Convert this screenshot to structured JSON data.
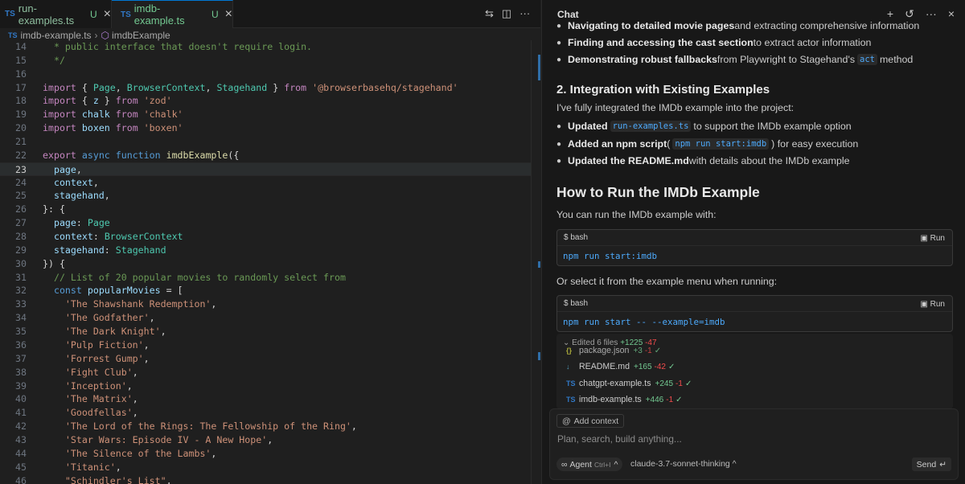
{
  "editor": {
    "tabs": [
      {
        "lang": "TS",
        "name": "run-examples.ts",
        "status": "U"
      },
      {
        "lang": "TS",
        "name": "imdb-example.ts",
        "status": "U"
      }
    ],
    "breadcrumb": {
      "lang": "TS",
      "file": "imdb-example.ts",
      "symbol": "imdbExample"
    },
    "lines": [
      {
        "n": "14",
        "t": "  * public interface that doesn't require login."
      },
      {
        "n": "15",
        "t": "  */"
      },
      {
        "n": "16",
        "t": ""
      },
      {
        "n": "17",
        "t": "import { Page, BrowserContext, Stagehand } from '@browserbasehq/stagehand'"
      },
      {
        "n": "18",
        "t": "import { z } from 'zod'"
      },
      {
        "n": "19",
        "t": "import chalk from 'chalk'"
      },
      {
        "n": "20",
        "t": "import boxen from 'boxen'"
      },
      {
        "n": "21",
        "t": ""
      },
      {
        "n": "22",
        "t": "export async function imdbExample({"
      },
      {
        "n": "23",
        "t": "  page,"
      },
      {
        "n": "24",
        "t": "  context,"
      },
      {
        "n": "25",
        "t": "  stagehand,"
      },
      {
        "n": "26",
        "t": "}: {"
      },
      {
        "n": "27",
        "t": "  page: Page"
      },
      {
        "n": "28",
        "t": "  context: BrowserContext"
      },
      {
        "n": "29",
        "t": "  stagehand: Stagehand"
      },
      {
        "n": "30",
        "t": "}) {"
      },
      {
        "n": "31",
        "t": "  // List of 20 popular movies to randomly select from"
      },
      {
        "n": "32",
        "t": "  const popularMovies = ["
      },
      {
        "n": "33",
        "t": "    'The Shawshank Redemption',"
      },
      {
        "n": "34",
        "t": "    'The Godfather',"
      },
      {
        "n": "35",
        "t": "    'The Dark Knight',"
      },
      {
        "n": "36",
        "t": "    'Pulp Fiction',"
      },
      {
        "n": "37",
        "t": "    'Forrest Gump',"
      },
      {
        "n": "38",
        "t": "    'Fight Club',"
      },
      {
        "n": "39",
        "t": "    'Inception',"
      },
      {
        "n": "40",
        "t": "    'The Matrix',"
      },
      {
        "n": "41",
        "t": "    'Goodfellas',"
      },
      {
        "n": "42",
        "t": "    'The Lord of the Rings: The Fellowship of the Ring',"
      },
      {
        "n": "43",
        "t": "    'Star Wars: Episode IV - A New Hope',"
      },
      {
        "n": "44",
        "t": "    'The Silence of the Lambs',"
      },
      {
        "n": "45",
        "t": "    'Titanic',"
      },
      {
        "n": "46",
        "t": "    \"Schindler's List\","
      }
    ],
    "active_line": "23"
  },
  "chat": {
    "title": "Chat",
    "bullets_top": [
      {
        "bold": "Navigating to detailed movie pages",
        "rest": " and extracting comprehensive information",
        "code": "",
        "after": ""
      },
      {
        "bold": "Finding and accessing the cast section",
        "rest": " to extract actor information",
        "code": "",
        "after": ""
      },
      {
        "bold": "Demonstrating robust fallbacks",
        "rest": " from Playwright to Stagehand's",
        "code": "act",
        "after": " method"
      }
    ],
    "h2": "2. Integration with Existing Examples",
    "para1": "I've fully integrated the IMDb example into the project:",
    "bullets_mid": [
      {
        "bold": "Updated",
        "rest": "",
        "code": "run-examples.ts",
        "after": "to support the IMDb example option"
      },
      {
        "bold": "Added an npm script",
        "rest": " (",
        "code": "npm run start:imdb",
        "after": ") for easy execution"
      },
      {
        "bold": "Updated the README.md",
        "rest": " with details about the IMDb example",
        "code": "",
        "after": ""
      }
    ],
    "h1": "How to Run the IMDb Example",
    "para2": "You can run the IMDb example with:",
    "code1": {
      "lang": "$ bash",
      "run": "Run",
      "cmd": "npm run start:imdb"
    },
    "para3": "Or select it from the example menu when running:",
    "code2": {
      "lang": "$ bash",
      "run": "Run",
      "cmd": "npm run start -- --example=imdb"
    },
    "edited": {
      "label": "Edited 6 files",
      "add": "+1225",
      "del": "-47",
      "files": [
        {
          "icon": "{}",
          "name": "package.json",
          "add": "+3",
          "del": "-1"
        },
        {
          "icon": "↓",
          "name": "README.md",
          "add": "+165",
          "del": "-42"
        },
        {
          "icon": "TS",
          "name": "chatgpt-example.ts",
          "add": "+245",
          "del": "-1"
        },
        {
          "icon": "TS",
          "name": "imdb-example.ts",
          "add": "+446",
          "del": "-1"
        }
      ]
    },
    "input": {
      "add_context": "Add context",
      "placeholder": "Plan, search, build anything...",
      "mode": "Agent",
      "mode_shortcut": "Ctrl+I",
      "model": "claude-3.7-sonnet-thinking",
      "send": "Send"
    }
  },
  "colors": {
    "accent": "#0078d4",
    "added": "#73c991",
    "deleted": "#f14c4c",
    "link": "#4daafc"
  }
}
